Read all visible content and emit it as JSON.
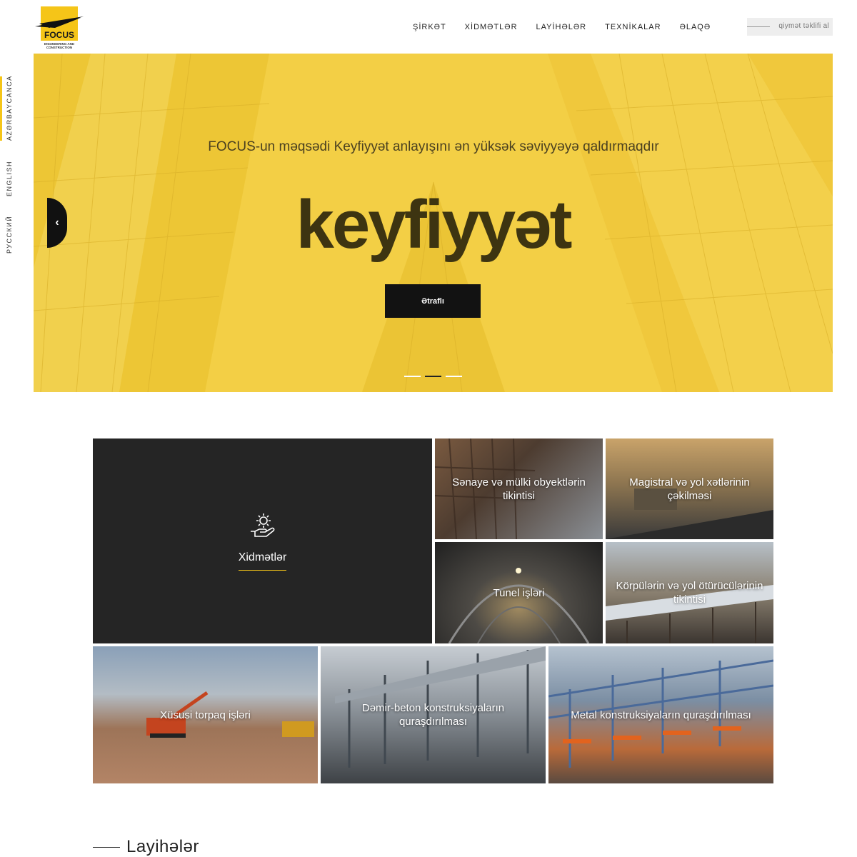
{
  "brand": {
    "name": "FOCUS",
    "tagline": "ENGINEERING AND CONSTRUCTION",
    "color": "#f5c518"
  },
  "nav": {
    "items": [
      "ŞİRKƏT",
      "XİDMƏTLƏR",
      "LAYİHƏLƏR",
      "TEXNİKALAR",
      "ƏLAQƏ"
    ],
    "quote_button": "qiymət təklifi al"
  },
  "languages": [
    "AZƏRBAYCANCA",
    "ENGLISH",
    "РУССКИЙ"
  ],
  "hero": {
    "subtitle": "FOCUS-un məqsədi Keyfiyyət anlayışını ən yüksək səviyyəyə qaldırmaqdır",
    "title": "keyfiyyət",
    "button": "Ətraflı",
    "prev_icon": "chevron-left-icon",
    "next_icon": "chevron-right-icon",
    "slides_total": 3,
    "active_slide": 2
  },
  "services": {
    "main_label": "Xidmətlər",
    "main_icon": "gear-hand-icon",
    "tiles": [
      "Sənaye və mülki obyektlərin tikintisi",
      "Magistral və yol xətlərinin çəkilməsi",
      "Tunel işləri",
      "Körpülərin və yol ötürücülərinin tikintisi",
      "Xüsusi torpaq işləri",
      "Dəmir-beton konstruksiyaların quraşdırılması",
      "Metal konstruksiyaların quraşdırılması"
    ]
  },
  "projects": {
    "title": "Layihələr"
  }
}
